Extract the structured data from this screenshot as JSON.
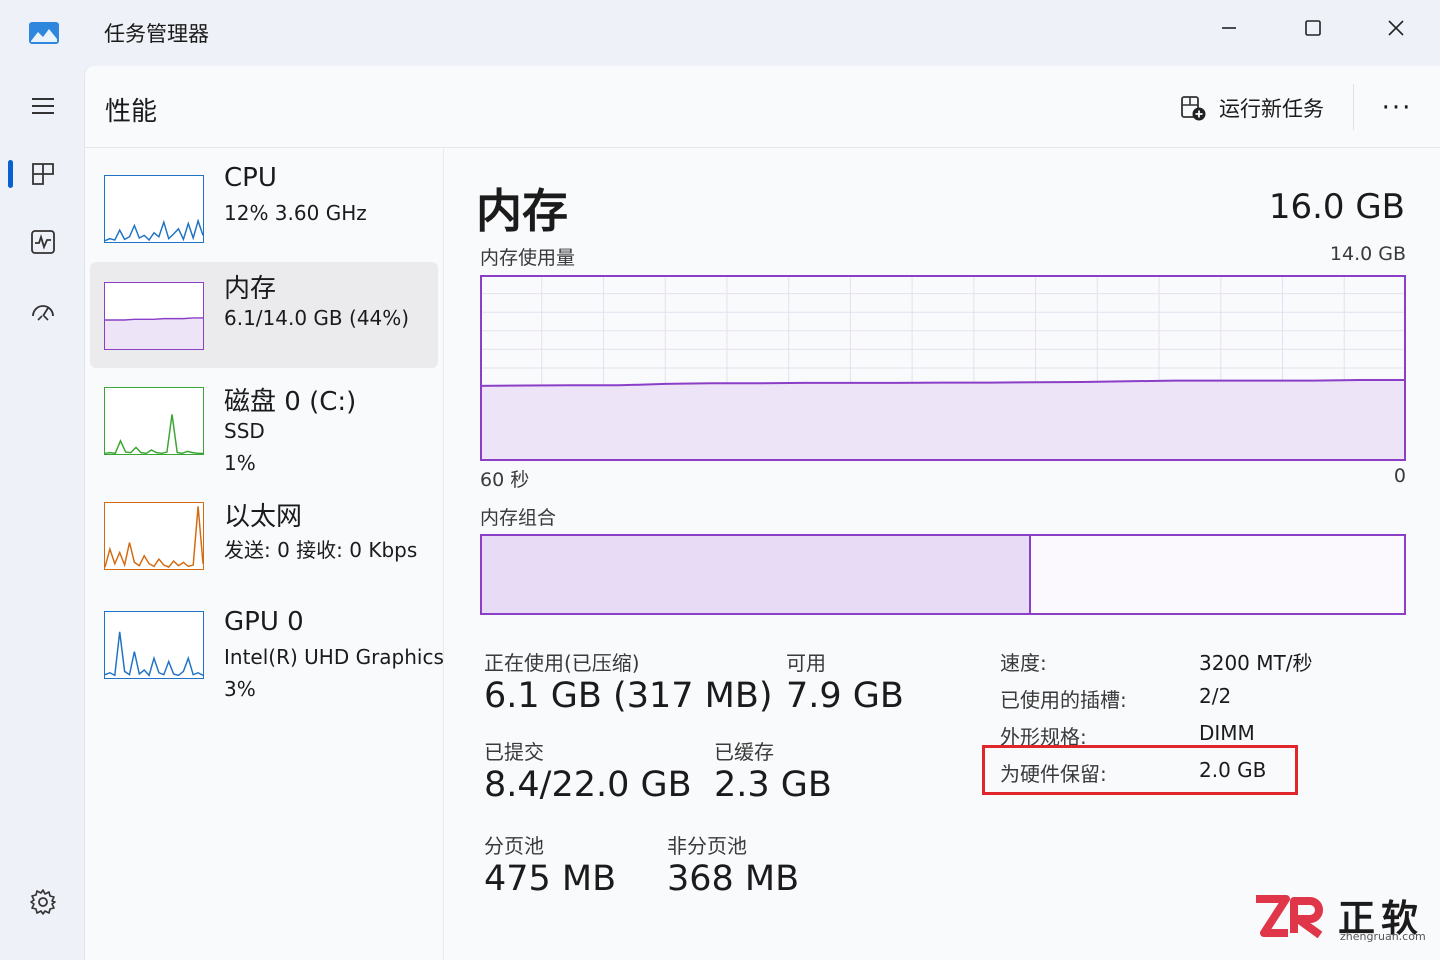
{
  "window": {
    "title": "任务管理器",
    "app_icon": "chart-mountain-icon",
    "controls": {
      "minimize_icon": "minimize-icon",
      "maximize_icon": "maximize-icon",
      "close_icon": "close-icon"
    }
  },
  "rail": {
    "menu_icon": "hamburger-icon",
    "items": [
      {
        "icon": "processes-grid-icon",
        "selected": true
      },
      {
        "icon": "performance-pulse-icon",
        "selected": false
      },
      {
        "icon": "startup-speedometer-icon",
        "selected": false
      }
    ],
    "settings": {
      "icon": "gear-icon",
      "label": "设置"
    }
  },
  "header": {
    "page_title": "性能",
    "run_task_label": "运行新任务",
    "run_task_icon": "new-task-icon",
    "more_label": "···"
  },
  "perf_list": [
    {
      "title": "CPU",
      "lines": [
        "12%  3.60 GHz"
      ],
      "color": "#1f72c5",
      "selected": false,
      "graph": [
        2,
        5,
        3,
        18,
        4,
        8,
        25,
        6,
        10,
        3,
        14,
        8,
        30,
        5,
        12,
        20,
        4,
        28,
        6,
        32,
        10
      ]
    },
    {
      "title": "内存",
      "lines": [
        "6.1/14.0 GB (44%)"
      ],
      "color": "#8b3fc6",
      "selected": true,
      "graph": [
        44,
        44,
        44,
        45,
        45,
        45,
        46,
        46,
        46,
        47,
        47
      ]
    },
    {
      "title": "磁盘 0 (C:)",
      "lines": [
        "SSD",
        "1%"
      ],
      "color": "#3aa534",
      "selected": false,
      "graph": [
        1,
        2,
        1,
        20,
        3,
        2,
        10,
        2,
        1,
        6,
        2,
        1,
        3,
        60,
        2,
        1,
        4,
        2,
        1,
        1
      ]
    },
    {
      "title": "以太网",
      "lines": [
        "发送: 0  接收: 0 Kbps"
      ],
      "color": "#d36a12",
      "selected": false,
      "graph": [
        3,
        30,
        8,
        25,
        6,
        40,
        10,
        5,
        20,
        8,
        4,
        15,
        6,
        3,
        12,
        5,
        10,
        4,
        6,
        95,
        8
      ]
    },
    {
      "title": "GPU 0",
      "lines": [
        "Intel(R) UHD Graphics",
        "3%"
      ],
      "color": "#1f72c5",
      "selected": false,
      "graph": [
        5,
        8,
        4,
        70,
        10,
        5,
        40,
        6,
        12,
        4,
        30,
        8,
        5,
        25,
        6,
        4,
        10,
        30,
        5,
        8,
        4
      ]
    }
  ],
  "detail": {
    "title": "内存",
    "total": "16.0 GB",
    "usage_label": "内存使用量",
    "usage_max": "14.0 GB",
    "time_left": "60 秒",
    "time_right": "0",
    "composition_label": "内存组合",
    "composition_in_use_fraction": 0.595,
    "accent_color": "#8b3fc6",
    "fill_color": "#ede4f8",
    "stats": {
      "in_use_label": "正在使用(已压缩)",
      "in_use_value": "6.1 GB (317 MB)",
      "available_label": "可用",
      "available_value": "7.9 GB",
      "committed_label": "已提交",
      "committed_value": "8.4/22.0 GB",
      "cached_label": "已缓存",
      "cached_value": "2.3 GB",
      "paged_label": "分页池",
      "paged_value": "475 MB",
      "nonpaged_label": "非分页池",
      "nonpaged_value": "368 MB"
    },
    "info": [
      {
        "label": "速度:",
        "value": "3200 MT/秒"
      },
      {
        "label": "已使用的插槽:",
        "value": "2/2"
      },
      {
        "label": "外形规格:",
        "value": "DIMM"
      },
      {
        "label": "为硬件保留:",
        "value": "2.0 GB"
      }
    ],
    "highlight_color": "#e0262a"
  },
  "chart_data": {
    "type": "area",
    "xlabel": "",
    "ylabel": "",
    "x": [
      60,
      57,
      54,
      51,
      48,
      45,
      42,
      39,
      36,
      33,
      30,
      27,
      24,
      21,
      18,
      15,
      12,
      9,
      6,
      3,
      0
    ],
    "ylim": [
      0,
      14.0
    ],
    "series": [
      {
        "values": [
          5.65,
          5.68,
          5.7,
          5.7,
          5.8,
          5.85,
          5.85,
          5.88,
          5.88,
          5.88,
          5.9,
          5.9,
          5.92,
          5.95,
          6.0,
          6.05,
          6.05,
          6.05,
          6.05,
          6.1,
          6.1
        ]
      }
    ],
    "grid": true
  },
  "watermark": {
    "logo": "zr-logo-icon",
    "text": "正软",
    "sub": "zhengruan.com"
  }
}
